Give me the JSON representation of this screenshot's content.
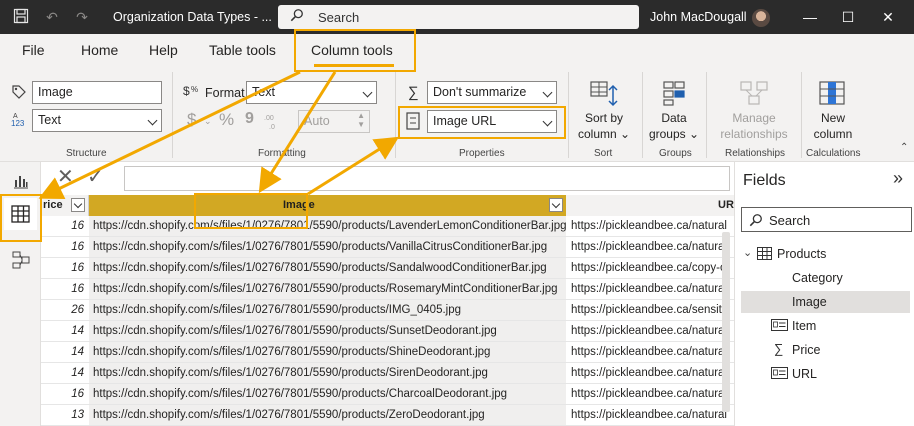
{
  "titlebar": {
    "title": "Organization Data Types - ...",
    "search_label": "Search",
    "user_name": "John MacDougall"
  },
  "menu": {
    "file": "File",
    "home": "Home",
    "help": "Help",
    "table_tools": "Table tools",
    "column_tools": "Column tools"
  },
  "ribbon": {
    "structure": {
      "name_value": "Image",
      "type_value": "Text",
      "label": "Structure"
    },
    "formatting": {
      "format_label": "Format",
      "format_value": "Text",
      "currency_symbol": "$",
      "percent_symbol": "%",
      "comma_symbol": "9",
      "decimals_value": "Auto",
      "label": "Formatting"
    },
    "properties": {
      "summarize_value": "Don't summarize",
      "category_value": "Image URL",
      "label": "Properties"
    },
    "sort": {
      "button_label_1": "Sort by",
      "button_label_2": "column",
      "label": "Sort"
    },
    "groups": {
      "button_label_1": "Data",
      "button_label_2": "groups",
      "label": "Groups"
    },
    "relationships": {
      "button_label_1": "Manage",
      "button_label_2": "relationships",
      "label": "Relationships"
    },
    "calculations": {
      "button_label_1": "New",
      "button_label_2": "column",
      "label": "Calculations"
    }
  },
  "grid": {
    "headers": {
      "price": "rice",
      "image": "Image",
      "url": "URL"
    },
    "rows": [
      {
        "price": "16",
        "image": "https://cdn.shopify.com/s/files/1/0276/7801/5590/products/LavenderLemonConditionerBar.jpg",
        "url": "https://pickleandbee.ca/natural"
      },
      {
        "price": "16",
        "image": "https://cdn.shopify.com/s/files/1/0276/7801/5590/products/VanillaCitrusConditionerBar.jpg",
        "url": "https://pickleandbee.ca/natural"
      },
      {
        "price": "16",
        "image": "https://cdn.shopify.com/s/files/1/0276/7801/5590/products/SandalwoodConditionerBar.jpg",
        "url": "https://pickleandbee.ca/copy-of"
      },
      {
        "price": "16",
        "image": "https://cdn.shopify.com/s/files/1/0276/7801/5590/products/RosemaryMintConditionerBar.jpg",
        "url": "https://pickleandbee.ca/natural"
      },
      {
        "price": "26",
        "image": "https://cdn.shopify.com/s/files/1/0276/7801/5590/products/IMG_0405.jpg",
        "url": "https://pickleandbee.ca/sensitiv"
      },
      {
        "price": "14",
        "image": "https://cdn.shopify.com/s/files/1/0276/7801/5590/products/SunsetDeodorant.jpg",
        "url": "https://pickleandbee.ca/natural"
      },
      {
        "price": "14",
        "image": "https://cdn.shopify.com/s/files/1/0276/7801/5590/products/ShineDeodorant.jpg",
        "url": "https://pickleandbee.ca/natural"
      },
      {
        "price": "14",
        "image": "https://cdn.shopify.com/s/files/1/0276/7801/5590/products/SirenDeodorant.jpg",
        "url": "https://pickleandbee.ca/natural"
      },
      {
        "price": "16",
        "image": "https://cdn.shopify.com/s/files/1/0276/7801/5590/products/CharcoalDeodorant.jpg",
        "url": "https://pickleandbee.ca/natural"
      },
      {
        "price": "13",
        "image": "https://cdn.shopify.com/s/files/1/0276/7801/5590/products/ZeroDeodorant.jpg",
        "url": "https://pickleandbee.ca/natural"
      }
    ]
  },
  "fields_pane": {
    "title": "Fields",
    "search_placeholder": "Search",
    "table_name": "Products",
    "fields": [
      {
        "label": "Category",
        "icon": "none"
      },
      {
        "label": "Image",
        "icon": "none",
        "selected": true
      },
      {
        "label": "Item",
        "icon": "text-field-icon"
      },
      {
        "label": "Price",
        "icon": "sigma-icon"
      },
      {
        "label": "URL",
        "icon": "text-field-icon"
      }
    ]
  },
  "colors": {
    "accent": "#f2a800",
    "selected_column_header": "#d2a823",
    "titlebar": "#2b2b2b",
    "ribbon": "#f3f2f1"
  }
}
